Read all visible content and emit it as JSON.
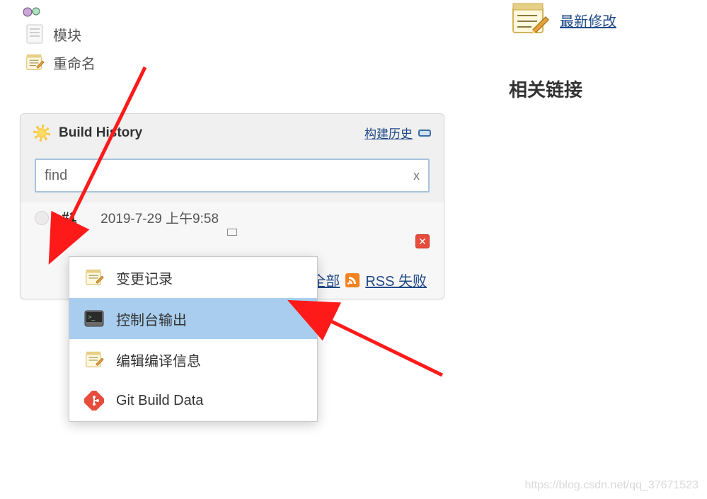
{
  "sidebar": {
    "items": [
      {
        "label": "模块"
      },
      {
        "label": "重命名"
      }
    ]
  },
  "panel": {
    "title": "Build History",
    "trend_link": "构建历史",
    "search_value": "find",
    "search_clear": "x",
    "build": {
      "id": "#1",
      "timestamp": "2019-7-29 上午9:58"
    },
    "footer": {
      "rss_all": "RSS 全部",
      "rss_fail": "RSS 失败"
    }
  },
  "context_menu": {
    "items": [
      {
        "label": "变更记录",
        "highlight": false
      },
      {
        "label": "控制台输出",
        "highlight": true
      },
      {
        "label": "编辑编译信息",
        "highlight": false
      },
      {
        "label": "Git Build Data",
        "highlight": false
      }
    ]
  },
  "right": {
    "recent_link": "最新修改",
    "related_title": "相关链接"
  },
  "watermark": "https://blog.csdn.net/qq_37671523"
}
